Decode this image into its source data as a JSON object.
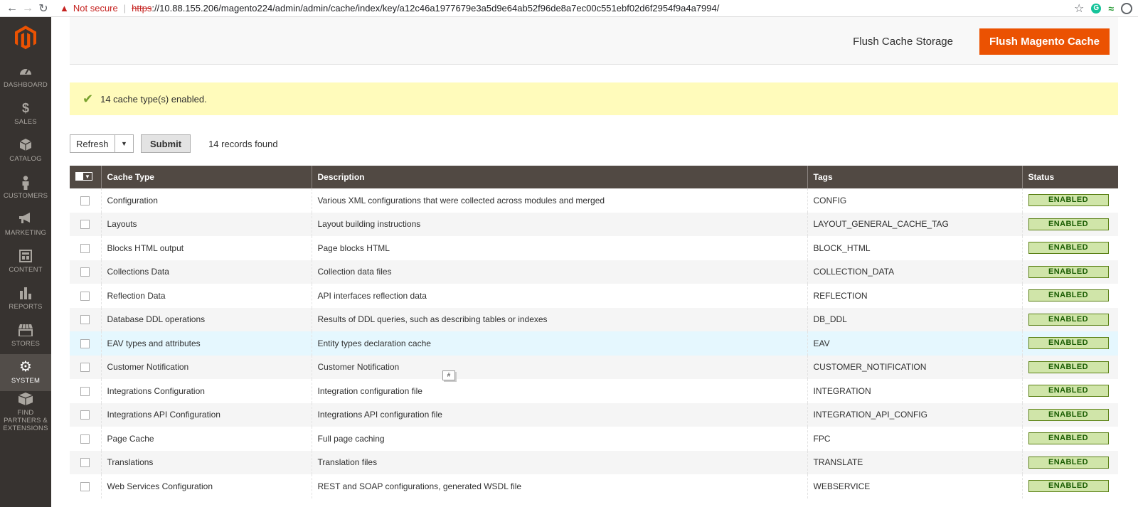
{
  "browser": {
    "not_secure": "Not secure",
    "url_scheme": "https",
    "url_rest": "://10.88.155.206/magento224/admin/admin/cache/index/key/a12c46a1977679e3a5d9e64ab52f96de8a7ec00c551ebf02d6f2954f9a4a7994/"
  },
  "sidebar": {
    "items": [
      {
        "label": "DASHBOARD",
        "icon": "dashboard-icon"
      },
      {
        "label": "SALES",
        "icon": "dollar-icon"
      },
      {
        "label": "CATALOG",
        "icon": "cube-icon"
      },
      {
        "label": "CUSTOMERS",
        "icon": "person-icon"
      },
      {
        "label": "MARKETING",
        "icon": "megaphone-icon"
      },
      {
        "label": "CONTENT",
        "icon": "content-icon"
      },
      {
        "label": "REPORTS",
        "icon": "bar-chart-icon"
      },
      {
        "label": "STORES",
        "icon": "store-icon"
      },
      {
        "label": "SYSTEM",
        "icon": "gear-icon"
      },
      {
        "label": "FIND PARTNERS & EXTENSIONS",
        "icon": "box-icon"
      }
    ]
  },
  "actions": {
    "flush_storage": "Flush Cache Storage",
    "flush_magento": "Flush Magento Cache"
  },
  "message": {
    "text": "14 cache type(s) enabled."
  },
  "toolbar": {
    "action_value": "Refresh",
    "submit": "Submit",
    "records": "14 records found"
  },
  "grid": {
    "headers": [
      "Cache Type",
      "Description",
      "Tags",
      "Status"
    ],
    "rows": [
      {
        "type": "Configuration",
        "desc": "Various XML configurations that were collected across modules and merged",
        "tags": "CONFIG",
        "status": "ENABLED"
      },
      {
        "type": "Layouts",
        "desc": "Layout building instructions",
        "tags": "LAYOUT_GENERAL_CACHE_TAG",
        "status": "ENABLED"
      },
      {
        "type": "Blocks HTML output",
        "desc": "Page blocks HTML",
        "tags": "BLOCK_HTML",
        "status": "ENABLED"
      },
      {
        "type": "Collections Data",
        "desc": "Collection data files",
        "tags": "COLLECTION_DATA",
        "status": "ENABLED"
      },
      {
        "type": "Reflection Data",
        "desc": "API interfaces reflection data",
        "tags": "REFLECTION",
        "status": "ENABLED"
      },
      {
        "type": "Database DDL operations",
        "desc": "Results of DDL queries, such as describing tables or indexes",
        "tags": "DB_DDL",
        "status": "ENABLED"
      },
      {
        "type": "EAV types and attributes",
        "desc": "Entity types declaration cache",
        "tags": "EAV",
        "status": "ENABLED"
      },
      {
        "type": "Customer Notification",
        "desc": "Customer Notification",
        "tags": "CUSTOMER_NOTIFICATION",
        "status": "ENABLED"
      },
      {
        "type": "Integrations Configuration",
        "desc": "Integration configuration file",
        "tags": "INTEGRATION",
        "status": "ENABLED"
      },
      {
        "type": "Integrations API Configuration",
        "desc": "Integrations API configuration file",
        "tags": "INTEGRATION_API_CONFIG",
        "status": "ENABLED"
      },
      {
        "type": "Page Cache",
        "desc": "Full page caching",
        "tags": "FPC",
        "status": "ENABLED"
      },
      {
        "type": "Translations",
        "desc": "Translation files",
        "tags": "TRANSLATE",
        "status": "ENABLED"
      },
      {
        "type": "Web Services Configuration",
        "desc": "REST and SOAP configurations, generated WSDL file",
        "tags": "WEBSERVICE",
        "status": "ENABLED"
      }
    ]
  },
  "tooltip": "#",
  "colors": {
    "accent": "#eb5202",
    "sidebar": "#373330",
    "header": "#514943",
    "message_bg": "#fffbbb",
    "status_bg": "#d0e5a9"
  }
}
